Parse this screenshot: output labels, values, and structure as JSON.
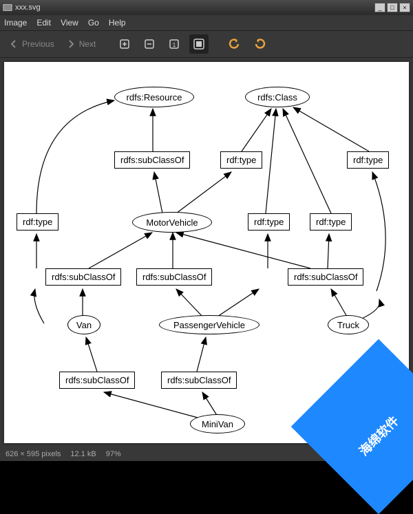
{
  "window": {
    "title": "xxx.svg"
  },
  "menu": {
    "image": "Image",
    "edit": "Edit",
    "view": "View",
    "go": "Go",
    "help": "Help"
  },
  "nav": {
    "previous": "Previous",
    "next": "Next"
  },
  "status": {
    "dimensions": "626 × 595 pixels",
    "filesize": "12.1 kB",
    "zoom": "97%"
  },
  "watermark": "海绵软件",
  "graph": {
    "nodes": {
      "resource": "rdfs:Resource",
      "class": "rdfs:Class",
      "motorvehicle": "MotorVehicle",
      "van": "Van",
      "passengervehicle": "PassengerVehicle",
      "truck": "Truck",
      "minivan": "MiniVan"
    },
    "edges": {
      "subclassof": "rdfs:subClassOf",
      "type": "rdf:type"
    }
  }
}
